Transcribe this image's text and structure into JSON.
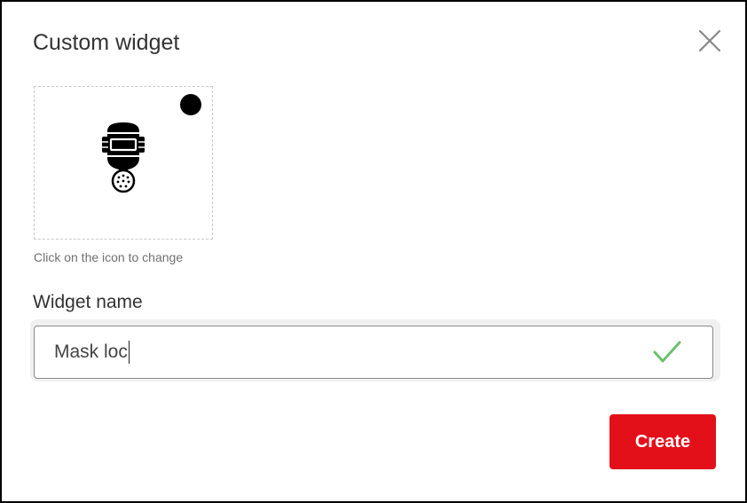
{
  "dialog": {
    "title": "Custom widget",
    "close_icon": "close-icon"
  },
  "icon_picker": {
    "icon": "gas-mask-icon",
    "hint": "Click on the icon to change"
  },
  "widget_name": {
    "label": "Widget name",
    "value": "Mask loc",
    "valid_icon": "checkmark-icon",
    "valid_color": "#6cc070"
  },
  "actions": {
    "create_label": "Create",
    "create_color": "#e3101a"
  }
}
